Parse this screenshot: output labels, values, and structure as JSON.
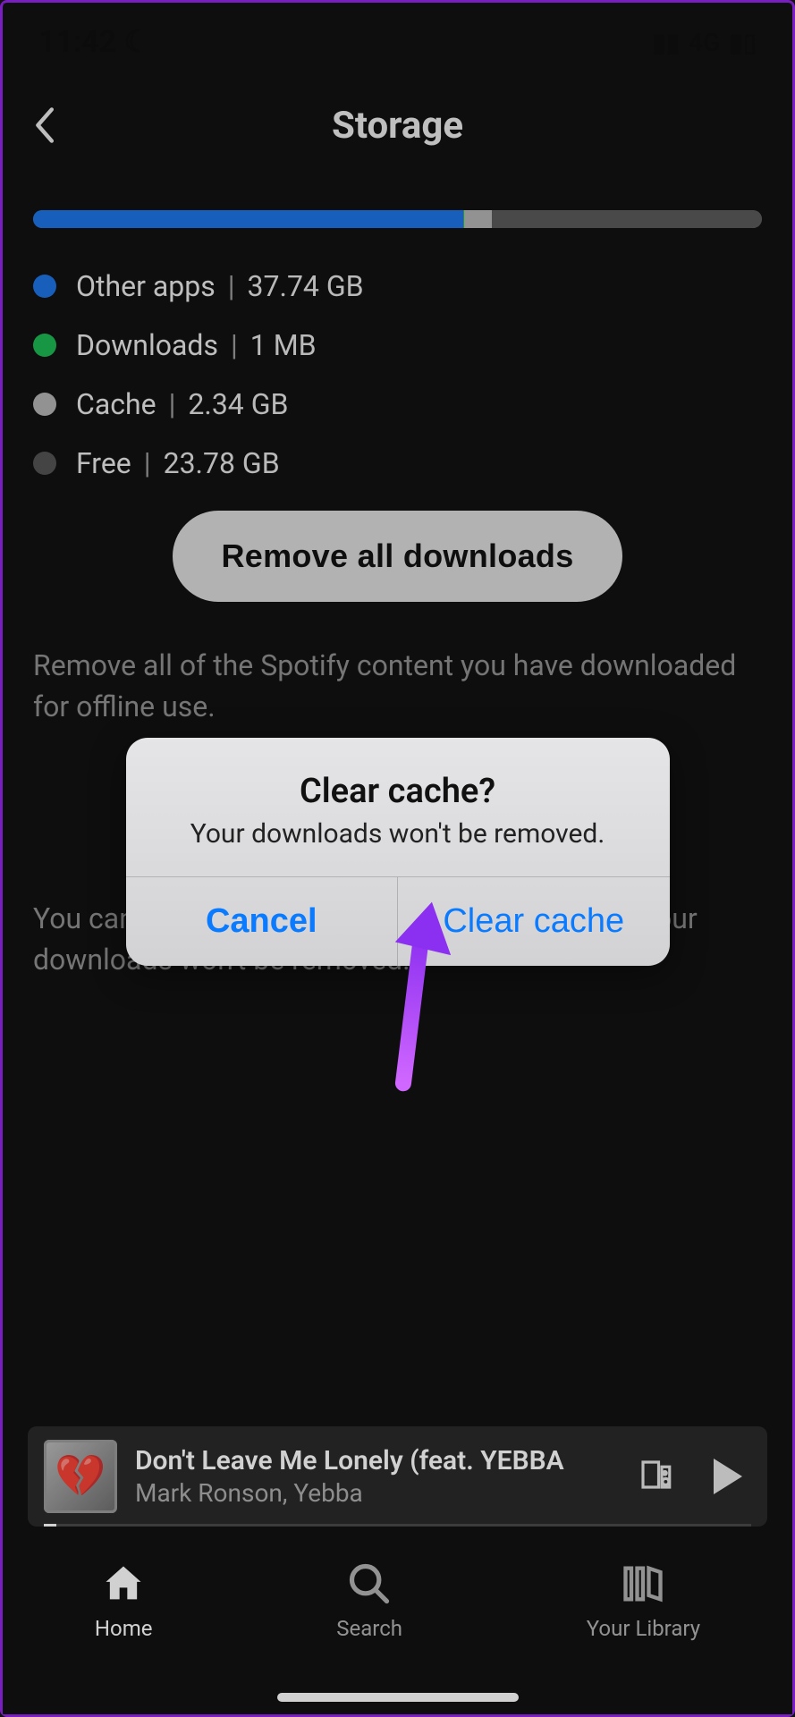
{
  "statusbar": {
    "time": "11:42",
    "network": "4G"
  },
  "header": {
    "title": "Storage"
  },
  "storage": {
    "segments": [
      {
        "pct": 59,
        "class": "blue"
      },
      {
        "pct": 0.2,
        "class": "green"
      },
      {
        "pct": 3.8,
        "class": "grey"
      },
      {
        "pct": 37,
        "class": "dark"
      }
    ],
    "legend": [
      {
        "color": "blue",
        "label": "Other apps",
        "value": "37.74 GB"
      },
      {
        "color": "green",
        "label": "Downloads",
        "value": "1 MB"
      },
      {
        "color": "grey",
        "label": "Cache",
        "value": "2.34 GB"
      },
      {
        "color": "dark",
        "label": "Free",
        "value": "23.78 GB"
      }
    ]
  },
  "buttons": {
    "remove_downloads": "Remove all downloads"
  },
  "descriptions": {
    "remove": "Remove all of the Spotify content you have downloaded for offline use.",
    "cache_partial": "You can free up storage by clearing your cache. Your downloads won't be removed."
  },
  "dialog": {
    "title": "Clear cache?",
    "message": "Your downloads won't be removed.",
    "cancel": "Cancel",
    "confirm": "Clear cache"
  },
  "nowplaying": {
    "title": "Don't Leave Me Lonely (feat. YEBBA",
    "artist": "Mark Ronson, Yebba"
  },
  "nav": {
    "home": "Home",
    "search": "Search",
    "library": "Your Library"
  }
}
